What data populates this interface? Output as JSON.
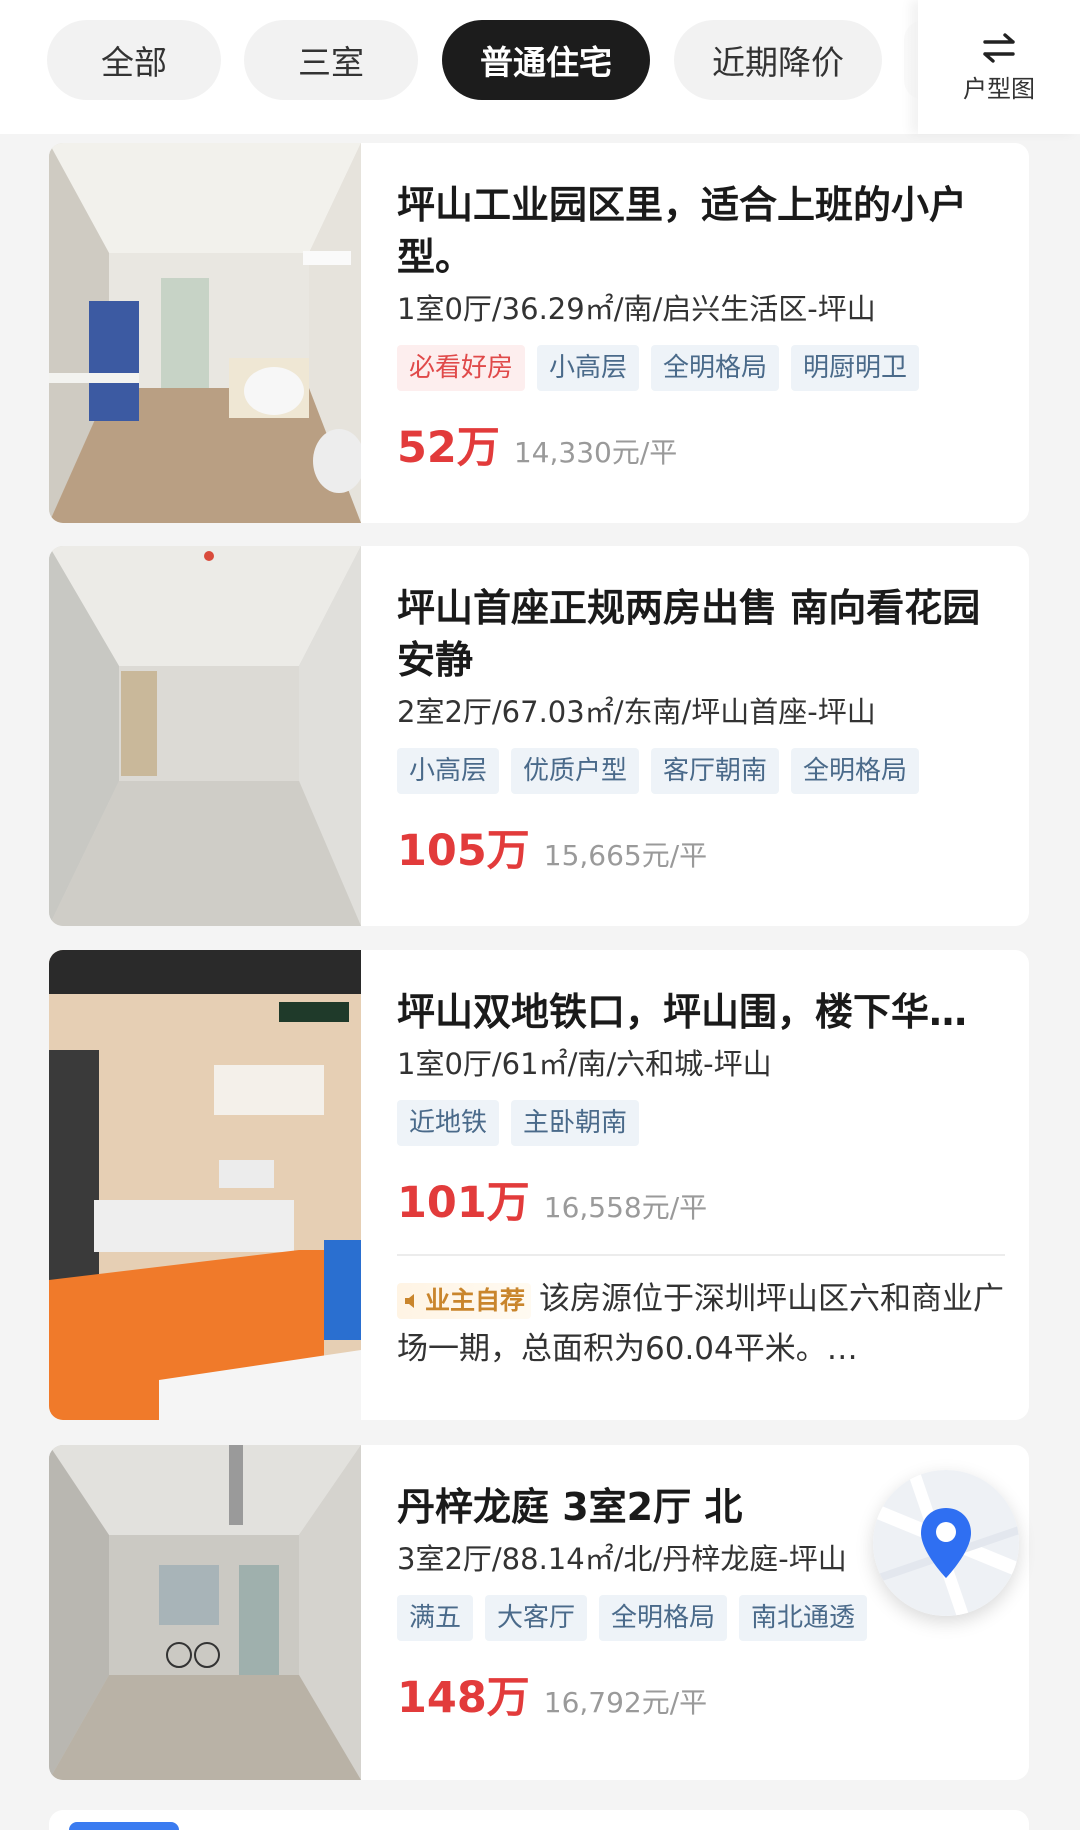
{
  "filters": {
    "chips": [
      {
        "label": "全部"
      },
      {
        "label": "三室"
      },
      {
        "label": "普通住宅"
      },
      {
        "label": "近期降价"
      }
    ],
    "layout_button_label": "户型图",
    "layout_icon": "swap-arrows-icon"
  },
  "listings": [
    {
      "title": "坪山工业园区里，适合上班的小户型。",
      "meta": "1室0厅/36.29㎡/南/启兴生活区-坪山",
      "tags": [
        "必看好房",
        "小高层",
        "全明格局",
        "明厨明卫"
      ],
      "price": "52万",
      "unit_price": "14,330元/平"
    },
    {
      "title": "坪山首座正规两房出售 南向看花园 安静",
      "meta": "2室2厅/67.03㎡/东南/坪山首座-坪山",
      "tags": [
        "小高层",
        "优质户型",
        "客厅朝南",
        "全明格局"
      ],
      "price": "105万",
      "unit_price": "15,665元/平"
    },
    {
      "title": "坪山双地铁口，坪山围，楼下华…",
      "meta": "1室0厅/61㎡/南/六和城-坪山",
      "tags": [
        "近地铁",
        "主卧朝南"
      ],
      "price": "101万",
      "unit_price": "16,558元/平",
      "owner_badge": "业主自荐",
      "owner_text": "该房源位于深圳坪山区六和商业广场一期，总面积为60.04平米。…"
    },
    {
      "title": "丹梓龙庭 3室2厅 北",
      "meta": "3室2厅/88.14㎡/北/丹梓龙庭-坪山",
      "tags": [
        "满五",
        "大客厅",
        "全明格局",
        "南北通透"
      ],
      "price": "148万",
      "unit_price": "16,792元/平"
    }
  ],
  "colors": {
    "price_red": "#e23b3b",
    "active_chip": "#1c1c1c",
    "tag_bg": "#eef3f8",
    "tag_text": "#4a6a8a",
    "hot_tag_text": "#e04a4a",
    "owner_badge": "#c9852c",
    "map_pin": "#2f6ff2"
  }
}
